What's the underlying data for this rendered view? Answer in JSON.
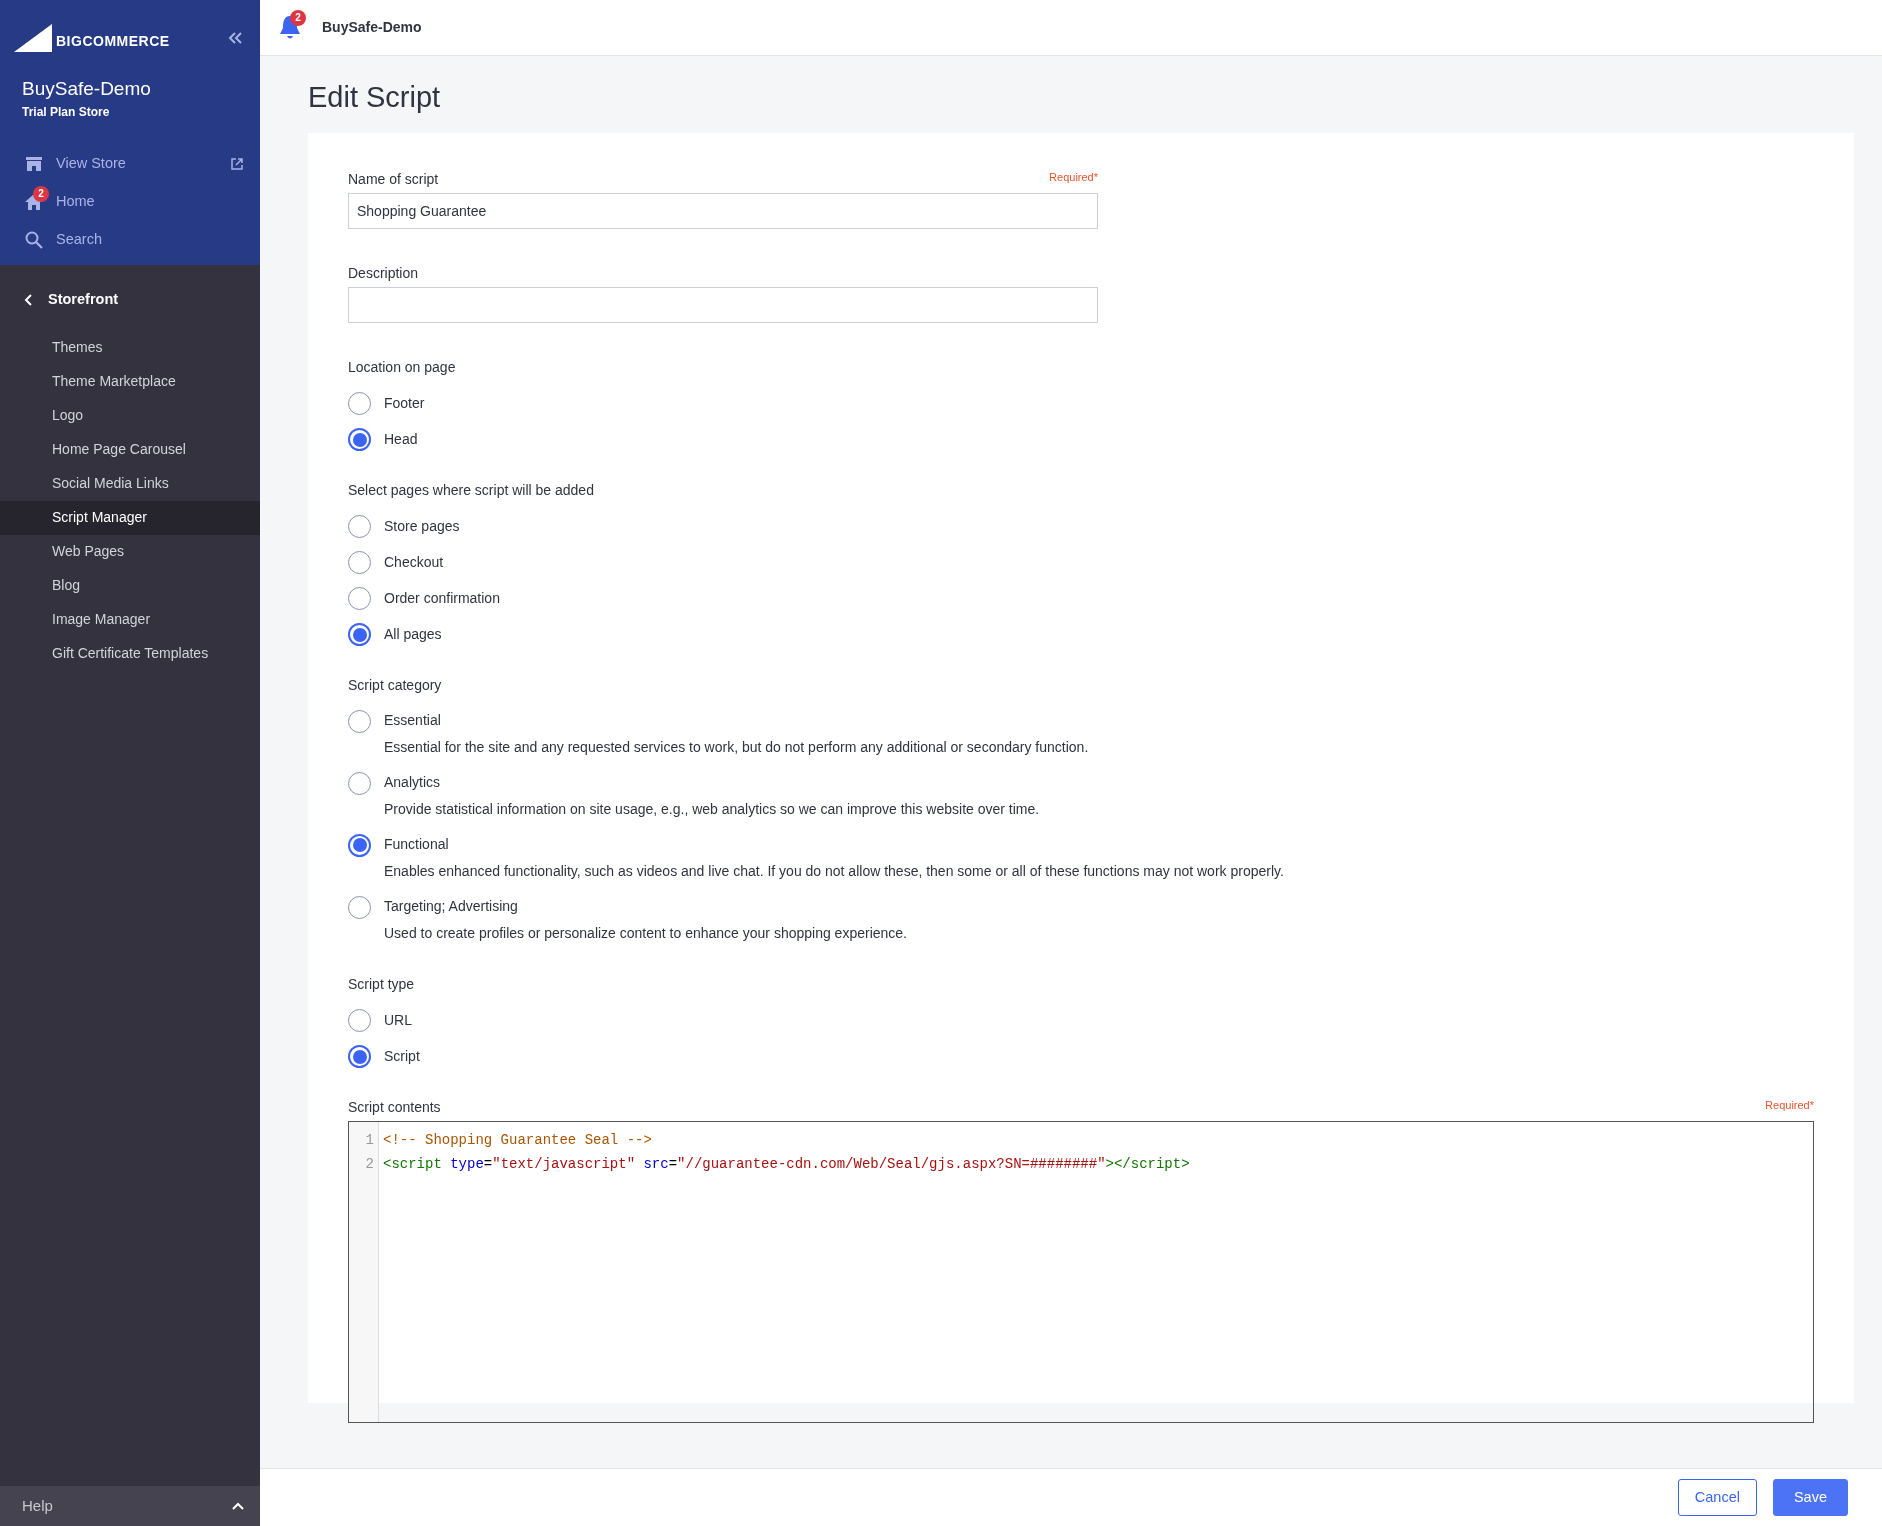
{
  "sidebar": {
    "logo": "BIGCOMMERCE",
    "store_name": "BuySafe-Demo",
    "plan": "Trial Plan Store",
    "nav": [
      {
        "label": "View Store",
        "kind": "store",
        "external": true
      },
      {
        "label": "Home",
        "kind": "home",
        "badge": "2"
      },
      {
        "label": "Search",
        "kind": "search"
      }
    ],
    "section": "Storefront",
    "items": [
      {
        "label": "Themes",
        "selected": false
      },
      {
        "label": "Theme Marketplace",
        "selected": false
      },
      {
        "label": "Logo",
        "selected": false
      },
      {
        "label": "Home Page Carousel",
        "selected": false
      },
      {
        "label": "Social Media Links",
        "selected": false
      },
      {
        "label": "Script Manager",
        "selected": true
      },
      {
        "label": "Web Pages",
        "selected": false
      },
      {
        "label": "Blog",
        "selected": false
      },
      {
        "label": "Image Manager",
        "selected": false
      },
      {
        "label": "Gift Certificate Templates",
        "selected": false
      }
    ],
    "help": "Help"
  },
  "topbar": {
    "notification_count": "2",
    "store_name": "BuySafe-Demo"
  },
  "page_title": "Edit Script",
  "fields": [
    {
      "label": "Name of script",
      "required": "Required*",
      "value": "Shopping Guarantee"
    },
    {
      "label": "Description"
    }
  ],
  "radio_groups": [
    {
      "label": "Location on page",
      "options": [
        {
          "label": "Footer",
          "selected": false
        },
        {
          "label": "Head",
          "selected": true
        }
      ]
    },
    {
      "label": "Select pages where script will be added",
      "options": [
        {
          "label": "Store pages",
          "selected": false
        },
        {
          "label": "Checkout",
          "selected": false
        },
        {
          "label": "Order confirmation",
          "selected": false
        },
        {
          "label": "All pages",
          "selected": true
        }
      ]
    },
    {
      "label": "Script category",
      "options": [
        {
          "label": "Essential",
          "selected": false,
          "description": "Essential for the site and any requested services to work, but do not perform any additional or secondary function."
        },
        {
          "label": "Analytics",
          "selected": false,
          "description": "Provide statistical information on site usage, e.g., web analytics so we can improve this website over time."
        },
        {
          "label": "Functional",
          "selected": true,
          "description": "Enables enhanced functionality, such as videos and live chat. If you do not allow these, then some or all of these functions may not work properly."
        },
        {
          "label": "Targeting; Advertising",
          "selected": false,
          "description": "Used to create profiles or personalize content to enhance your shopping experience."
        }
      ]
    },
    {
      "label": "Script type",
      "options": [
        {
          "label": "URL",
          "selected": false
        },
        {
          "label": "Script",
          "selected": true
        }
      ]
    }
  ],
  "script_contents": {
    "label": "Script contents",
    "required": "Required*",
    "lines": [
      {
        "number": "1",
        "tokens": [
          {
            "kind": "comment",
            "text": "<!-- Shopping Guarantee Seal -->"
          }
        ]
      },
      {
        "number": "2",
        "tokens": [
          {
            "kind": "tag",
            "text": "<script"
          },
          {
            "kind": "attr",
            "text": " type"
          },
          {
            "kind": "plain",
            "text": "="
          },
          {
            "kind": "string",
            "text": "\"text/javascript\""
          },
          {
            "kind": "attr",
            "text": " src"
          },
          {
            "kind": "plain",
            "text": "="
          },
          {
            "kind": "string",
            "text": "\"//guarantee-cdn.com/Web/Seal/gjs.aspx?SN=########\""
          },
          {
            "kind": "tag",
            "text": "></script>"
          }
        ]
      }
    ]
  },
  "buttons": [
    {
      "label": "Cancel",
      "kind": "secondary"
    },
    {
      "label": "Save",
      "kind": "primary"
    }
  ]
}
